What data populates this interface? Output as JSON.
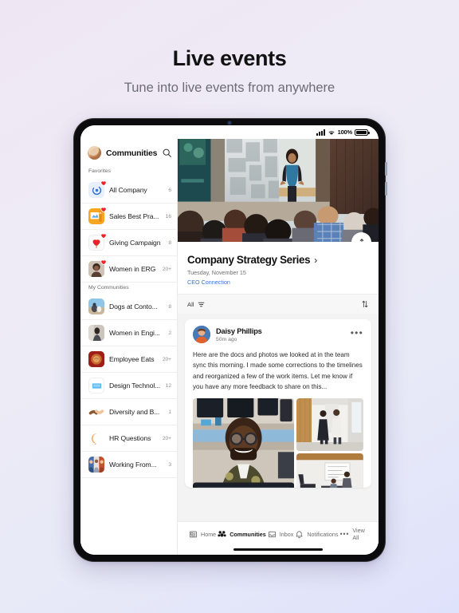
{
  "promo": {
    "title": "Live events",
    "subtitle": "Tune into live events from anywhere"
  },
  "status_bar": {
    "battery_percent": "100%",
    "signal_icon": "cellular-signal-icon",
    "wifi_icon": "wifi-icon",
    "battery_icon": "battery-icon"
  },
  "sidebar": {
    "avatar_name": "user-avatar",
    "title": "Communities",
    "search_icon": "search-icon",
    "sections": [
      {
        "label": "Favorites",
        "items": [
          {
            "label": "All Company",
            "count": "6",
            "icon": "community-icon-all-company",
            "favorite": true
          },
          {
            "label": "Sales Best Pra...",
            "count": "16",
            "icon": "community-icon-sales-best-practices",
            "favorite": true
          },
          {
            "label": "Giving Campaign",
            "count": "8",
            "icon": "community-icon-giving-campaign",
            "favorite": true
          },
          {
            "label": "Women in ERG",
            "count": "20+",
            "icon": "community-icon-women-in-erg",
            "favorite": true
          }
        ]
      },
      {
        "label": "My Communities",
        "items": [
          {
            "label": "Dogs at Conto...",
            "count": "8",
            "icon": "community-icon-dogs-at-contoso",
            "favorite": false
          },
          {
            "label": "Women in Engi...",
            "count": "2",
            "icon": "community-icon-women-in-engineering",
            "favorite": false
          },
          {
            "label": "Employee Eats",
            "count": "20+",
            "icon": "community-icon-employee-eats",
            "favorite": false
          },
          {
            "label": "Design Technol...",
            "count": "12",
            "icon": "community-icon-design-technology",
            "favorite": false
          },
          {
            "label": "Diversity and B...",
            "count": "1",
            "icon": "community-icon-diversity-and-belonging",
            "favorite": false
          },
          {
            "label": "HR Questions",
            "count": "20+",
            "icon": "community-icon-hr-questions",
            "favorite": false
          },
          {
            "label": "Working From...",
            "count": "3",
            "icon": "community-icon-working-from-home",
            "favorite": false
          }
        ]
      }
    ]
  },
  "main": {
    "hero_image": "live-event-audience-photo",
    "share_icon": "share-icon",
    "event": {
      "title": "Company Strategy Series",
      "chevron": "›",
      "date": "Tuesday, November 15",
      "community_link": "CEO Connection"
    },
    "filter_bar": {
      "label": "All",
      "filter_icon": "filter-icon",
      "sort_icon": "sort-icon"
    },
    "post": {
      "avatar": "daisy-phillips-avatar",
      "author": "Daisy Phillips",
      "time": "50m ago",
      "more_icon": "more-options-icon",
      "body": "Here are the docs and photos we looked at in the team sync this morning. I made some corrections to the timelines and reorganized a few of the work items. Let me know if you have any more feedback to share on this...",
      "images": [
        "photo-man-at-desk",
        "photo-office-hallway",
        "photo-office-meeting"
      ]
    }
  },
  "tabbar": {
    "items": [
      {
        "label": "Home",
        "icon": "home-icon",
        "active": false
      },
      {
        "label": "Communities",
        "icon": "communities-icon",
        "active": true
      },
      {
        "label": "Inbox",
        "icon": "inbox-icon",
        "active": false
      },
      {
        "label": "Notifications",
        "icon": "bell-icon",
        "active": false
      },
      {
        "label": "View All",
        "icon": "ellipsis-icon",
        "active": false
      }
    ]
  },
  "colors": {
    "accent_link": "#3f6fd8",
    "favorite_heart": "#e8252a",
    "background_start": "#efe6f4",
    "background_end": "#dfe2fb"
  }
}
